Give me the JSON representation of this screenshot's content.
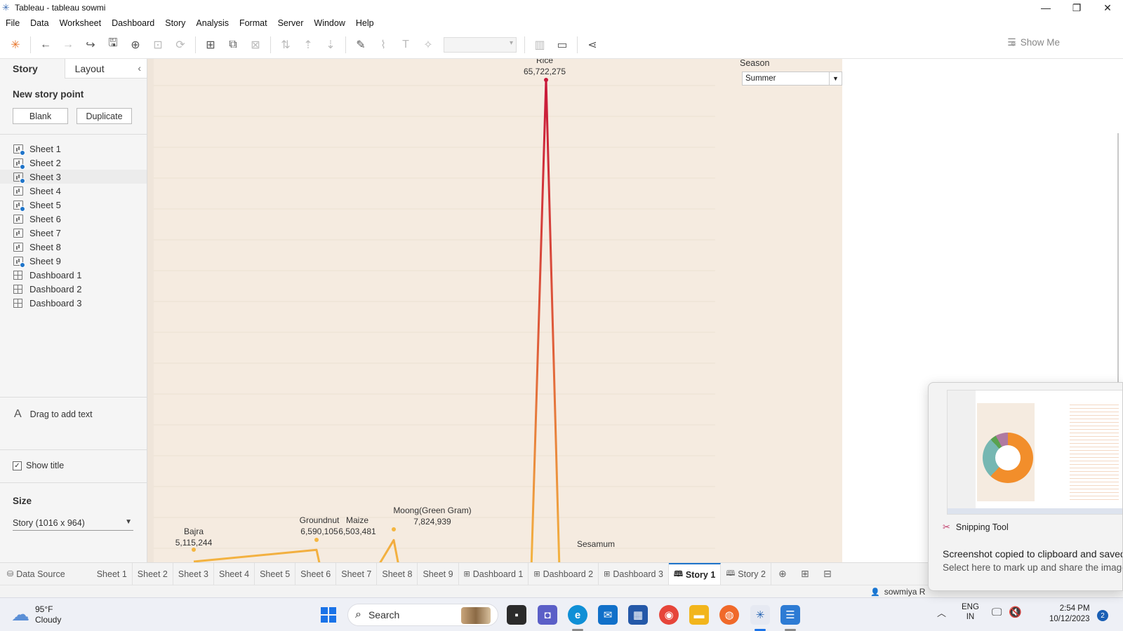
{
  "window": {
    "title": "Tableau - tableau sowmi",
    "controls": {
      "minimize": "—",
      "restore": "❐",
      "close": "✕"
    }
  },
  "menu": [
    "File",
    "Data",
    "Worksheet",
    "Dashboard",
    "Story",
    "Analysis",
    "Format",
    "Server",
    "Window",
    "Help"
  ],
  "toolbar": {
    "show_me_label": "Show Me"
  },
  "left_pane": {
    "tabs": {
      "story": "Story",
      "layout": "Layout",
      "collapse": "‹"
    },
    "new_story_point": "New story point",
    "blank_label": "Blank",
    "duplicate_label": "Duplicate",
    "sheets": [
      {
        "label": "Sheet 1",
        "kind": "sheet",
        "used": true
      },
      {
        "label": "Sheet 2",
        "kind": "sheet",
        "used": true
      },
      {
        "label": "Sheet 3",
        "kind": "sheet",
        "used": true
      },
      {
        "label": "Sheet 4",
        "kind": "sheet",
        "used": false
      },
      {
        "label": "Sheet 5",
        "kind": "sheet",
        "used": true
      },
      {
        "label": "Sheet 6",
        "kind": "sheet",
        "used": false
      },
      {
        "label": "Sheet 7",
        "kind": "sheet",
        "used": false
      },
      {
        "label": "Sheet 8",
        "kind": "sheet",
        "used": false
      },
      {
        "label": "Sheet 9",
        "kind": "sheet",
        "used": true
      },
      {
        "label": "Dashboard 1",
        "kind": "dashboard",
        "used": false
      },
      {
        "label": "Dashboard 2",
        "kind": "dashboard",
        "used": false
      },
      {
        "label": "Dashboard 3",
        "kind": "dashboard",
        "used": false
      }
    ],
    "drag_text": "Drag to add text",
    "show_title": "Show title",
    "size_header": "Size",
    "size_value": "Story (1016 x 964)"
  },
  "filter": {
    "label": "Season",
    "value": "Summer"
  },
  "chart_data": {
    "type": "line",
    "categories": [
      "Bajra",
      "Groundnut",
      "Maize",
      "Moong(Green Gram)",
      "Rice",
      "Sesamum"
    ],
    "values": [
      5115244,
      6590105,
      6503481,
      7824939,
      65722275,
      null
    ],
    "labels": [
      "5,115,244",
      "6,590,105",
      "6,503,481",
      "7,824,939",
      "65,722,275",
      ""
    ],
    "line_color_high": "#c8183a",
    "line_color_low": "#f4b640",
    "background": "#f5ebe0"
  },
  "bottom_tabs": {
    "data_source": "Data Source",
    "tabs": [
      {
        "label": "Sheet 1",
        "icon": ""
      },
      {
        "label": "Sheet 2",
        "icon": ""
      },
      {
        "label": "Sheet 3",
        "icon": ""
      },
      {
        "label": "Sheet 4",
        "icon": ""
      },
      {
        "label": "Sheet 5",
        "icon": ""
      },
      {
        "label": "Sheet 6",
        "icon": ""
      },
      {
        "label": "Sheet 7",
        "icon": ""
      },
      {
        "label": "Sheet 8",
        "icon": ""
      },
      {
        "label": "Sheet 9",
        "icon": ""
      },
      {
        "label": "Dashboard 1",
        "icon": "⊞"
      },
      {
        "label": "Dashboard 2",
        "icon": "⊞"
      },
      {
        "label": "Dashboard 3",
        "icon": "⊞"
      },
      {
        "label": "Story 1",
        "icon": "🕮",
        "active": true
      },
      {
        "label": "Story 2",
        "icon": "🕮"
      }
    ]
  },
  "status": {
    "user": "sowmiya R"
  },
  "taskbar": {
    "weather_temp": "95°F",
    "weather_desc": "Cloudy",
    "search_label": "Search",
    "lang_line1": "ENG",
    "lang_line2": "IN",
    "time": "2:54 PM",
    "date": "10/12/2023",
    "notifications": "2"
  },
  "toast": {
    "app_name": "Snipping Tool",
    "message_line1": "Screenshot copied to clipboard and saved",
    "message_line2": "Select here to mark up and share the image"
  }
}
